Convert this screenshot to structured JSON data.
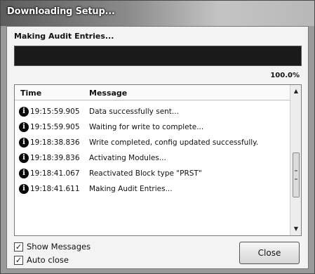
{
  "window": {
    "title": "Downloading Setup..."
  },
  "status": {
    "label": "Making Audit Entries..."
  },
  "progress": {
    "value": 1.0,
    "percent_text": "100.0%"
  },
  "log": {
    "columns": {
      "time": "Time",
      "message": "Message"
    },
    "rows": [
      {
        "time": "19:15:59.905",
        "message": "Data successfully sent..."
      },
      {
        "time": "19:15:59.905",
        "message": "Waiting for write to complete..."
      },
      {
        "time": "19:18:38.836",
        "message": "Write completed, config updated successfully."
      },
      {
        "time": "19:18:39.836",
        "message": "Activating Modules..."
      },
      {
        "time": "19:18:41.067",
        "message": "Reactivated Block type \"PRST\""
      },
      {
        "time": "19:18:41.611",
        "message": "Making Audit Entries..."
      }
    ],
    "row_icon": "info-icon"
  },
  "options": {
    "show_messages": {
      "label": "Show Messages",
      "checked": true
    },
    "auto_close": {
      "label": "Auto close",
      "checked": true
    }
  },
  "buttons": {
    "close": "Close"
  }
}
